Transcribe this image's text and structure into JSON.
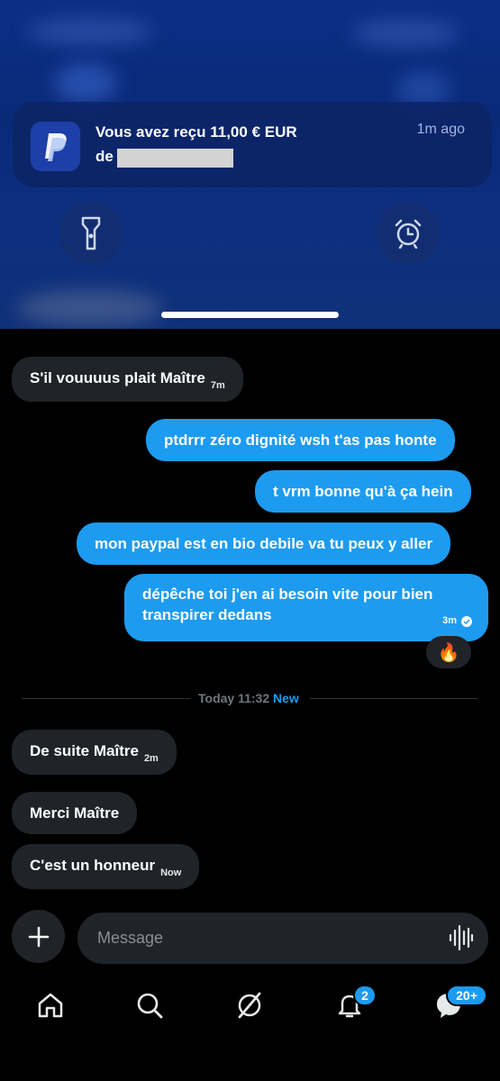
{
  "notification": {
    "title": "Vous avez reçu 11,00 € EUR",
    "subtitle": "de",
    "time": "1m ago"
  },
  "quick_actions": {
    "left_icon": "flashlight-icon",
    "right_icon": "alarm-icon"
  },
  "messages": [
    {
      "side": "in",
      "text": "S'il vouuuus plait Maître",
      "time": "7m"
    },
    {
      "side": "out",
      "text": "ptdrrr zéro dignité wsh t'as pas honte"
    },
    {
      "side": "out",
      "text": "t vrm bonne qu'à ça hein"
    },
    {
      "side": "out",
      "text": "mon paypal est en bio debile va tu peux y aller"
    },
    {
      "side": "out",
      "line1": "dépêche toi j'en ai besoin vite pour bien",
      "line2": "transpirer dedans",
      "time": "3m",
      "reaction": "🔥"
    },
    {
      "side": "in",
      "text": "De suite Maître",
      "time": "2m"
    },
    {
      "side": "in",
      "text": "Merci Maître"
    },
    {
      "side": "in",
      "text": "C'est un honneur",
      "time": "Now"
    }
  ],
  "divider": {
    "label": "Today 11:32",
    "new_label": "New"
  },
  "composer": {
    "placeholder": "Message"
  },
  "tabbar": {
    "notifications_badge": "2",
    "messages_badge": "20+"
  },
  "colors": {
    "accent": "#1d9bf0",
    "incoming_bubble": "#202327",
    "overlay_blue": "#0c2f86"
  }
}
